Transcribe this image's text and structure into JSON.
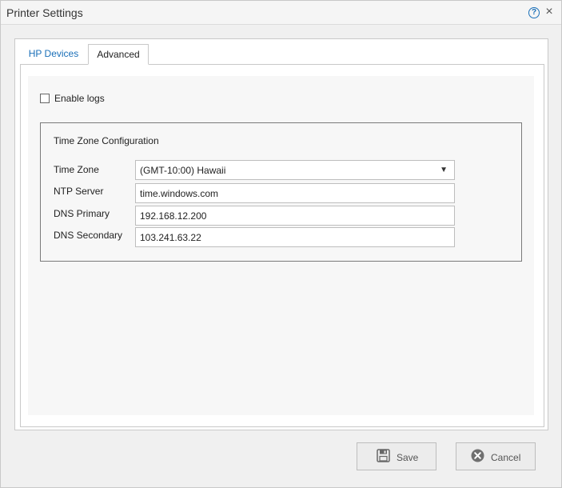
{
  "dialog": {
    "title": "Printer Settings",
    "help_icon": "help-icon",
    "close_icon": "close-icon"
  },
  "tabs": [
    {
      "label": "HP Devices",
      "active": false
    },
    {
      "label": "Advanced",
      "active": true
    }
  ],
  "advanced": {
    "enable_logs_label": "Enable logs",
    "enable_logs_checked": false,
    "time_zone_section": {
      "title": "Time Zone Configuration",
      "time_zone_label": "Time Zone",
      "time_zone_value": "(GMT-10:00) Hawaii",
      "ntp_label": "NTP Server",
      "ntp_value": "time.windows.com",
      "dns_primary_label": "DNS Primary",
      "dns_primary_value": "192.168.12.200",
      "dns_secondary_label": "DNS Secondary",
      "dns_secondary_value": "103.241.63.22"
    }
  },
  "footer": {
    "save_label": "Save",
    "cancel_label": "Cancel",
    "save_icon": "floppy-disk-icon",
    "cancel_icon": "cancel-circle-icon"
  },
  "colors": {
    "link_blue": "#1a6fb8",
    "panel_border": "#c9c9c9"
  }
}
